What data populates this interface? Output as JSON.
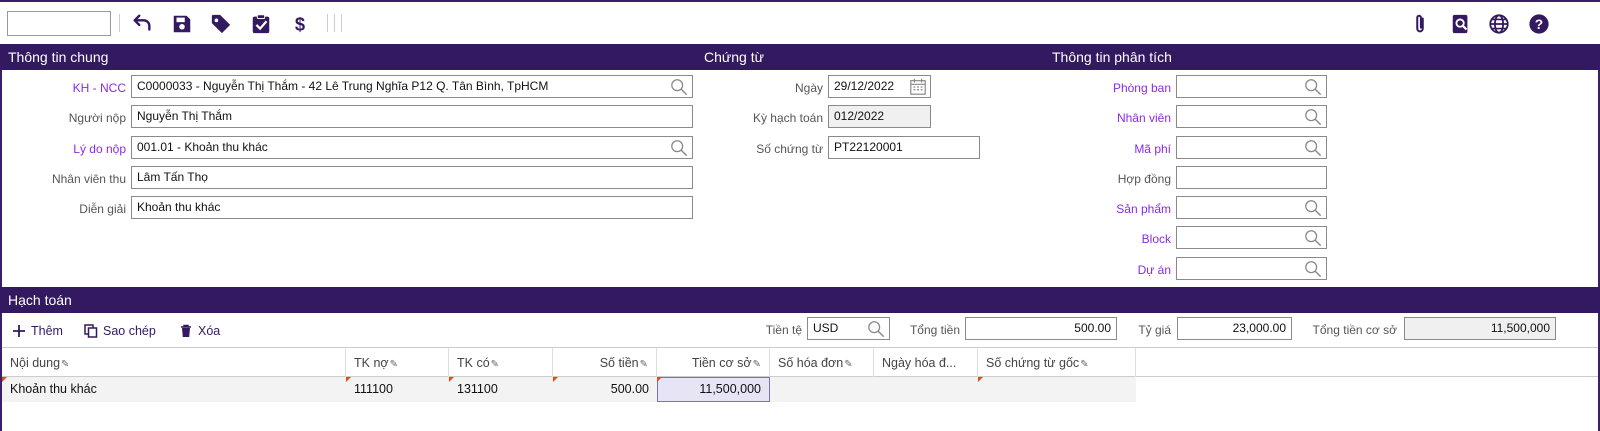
{
  "toolbar": {
    "search_value": "",
    "icons": [
      "undo-icon",
      "save-icon",
      "tag-icon",
      "clipboard-check-icon",
      "dollar-icon",
      "paperclip-icon",
      "preview-icon",
      "globe-icon",
      "help-icon"
    ]
  },
  "sections": {
    "general": "Thông tin chung",
    "voucher": "Chứng từ",
    "analysis": "Thông tin phân tích",
    "accounting": "Hạch toán"
  },
  "general": {
    "kh_ncc": {
      "label": "KH - NCC",
      "value": "C0000033 - Nguyễn Thị Thắm - 42 Lê Trung Nghĩa P12 Q. Tân Bình, TpHCM"
    },
    "nguoi_nop": {
      "label": "Người nộp",
      "value": "Nguyễn Thị Thắm"
    },
    "ly_do_nop": {
      "label": "Lý do nộp",
      "value": "001.01 - Khoản thu khác"
    },
    "nhan_vien_thu": {
      "label": "Nhân viên thu",
      "value": "Lâm Tấn Thọ"
    },
    "dien_giai": {
      "label": "Diễn giải",
      "value": "Khoản thu khác"
    }
  },
  "voucher": {
    "ngay": {
      "label": "Ngày",
      "value": "29/12/2022"
    },
    "ky_hach_toan": {
      "label": "Kỳ hạch toán",
      "value": "012/2022"
    },
    "so_chung_tu": {
      "label": "Số chứng từ",
      "value": "PT22120001"
    }
  },
  "analysis": {
    "phong_ban": {
      "label": "Phòng ban",
      "value": ""
    },
    "nhan_vien": {
      "label": "Nhân viên",
      "value": ""
    },
    "ma_phi": {
      "label": "Mã phí",
      "value": ""
    },
    "hop_dong": {
      "label": "Hợp đồng",
      "value": ""
    },
    "san_pham": {
      "label": "Sản phẩm",
      "value": ""
    },
    "block": {
      "label": "Block",
      "value": ""
    },
    "du_an": {
      "label": "Dự án",
      "value": ""
    }
  },
  "accounting": {
    "add_label": "Thêm",
    "copy_label": "Sao chép",
    "delete_label": "Xóa",
    "tien_te": {
      "label": "Tiền tệ",
      "value": "USD"
    },
    "tong_tien": {
      "label": "Tổng tiền",
      "value": "500.00"
    },
    "ty_gia": {
      "label": "Tỷ giá",
      "value": "23,000.00"
    },
    "tong_tien_co_so": {
      "label": "Tổng tiền cơ sở",
      "value": "11,500,000"
    },
    "columns": [
      "Nội dung",
      "TK nợ",
      "TK có",
      "Số tiền",
      "Tiền cơ sở",
      "Số hóa đơn",
      "Ngày hóa đ...",
      "Số chứng từ gốc"
    ],
    "rows": [
      {
        "noi_dung": "Khoản thu khác",
        "tk_no": "111100",
        "tk_co": "131100",
        "so_tien": "500.00",
        "tien_co_so": "11,500,000",
        "so_hoa_don": "",
        "ngay_hoa_don": "",
        "so_chung_tu_goc": ""
      }
    ]
  },
  "colors": {
    "primary": "#33195f",
    "link": "#8a2be2",
    "flag": "#e04b1a"
  }
}
